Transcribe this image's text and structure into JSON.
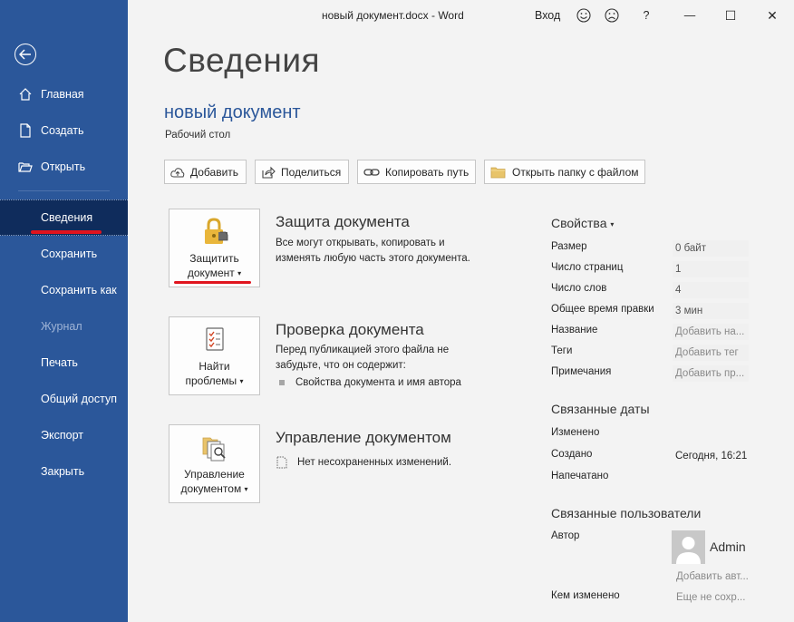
{
  "window": {
    "title": "новый документ.docx  -  Word",
    "signin": "Вход",
    "help": "?",
    "minimize": "—",
    "maximize": "☐",
    "close": "✕"
  },
  "sidebar": {
    "items": [
      {
        "label": "Главная"
      },
      {
        "label": "Создать"
      },
      {
        "label": "Открыть"
      },
      {
        "label": "Сведения"
      },
      {
        "label": "Сохранить"
      },
      {
        "label": "Сохранить как"
      },
      {
        "label": "Журнал"
      },
      {
        "label": "Печать"
      },
      {
        "label": "Общий доступ"
      },
      {
        "label": "Экспорт"
      },
      {
        "label": "Закрыть"
      }
    ]
  },
  "main": {
    "title": "Сведения",
    "doc_name": "новый документ",
    "doc_path": "Рабочий стол",
    "actions": {
      "upload": "Добавить",
      "share": "Поделиться",
      "copy_path": "Копировать путь",
      "open_folder": "Открыть папку с файлом"
    },
    "protect": {
      "btn_line1": "Защитить",
      "btn_line2": "документ",
      "title": "Защита документа",
      "desc_line1": "Все могут открывать, копировать и",
      "desc_line2": "изменять любую часть этого документа."
    },
    "inspect": {
      "btn_line1": "Найти",
      "btn_line2": "проблемы",
      "title": "Проверка документа",
      "desc_line1": "Перед публикацией этого файла не",
      "desc_line2": "забудьте, что он содержит:",
      "bullet": "Свойства документа и имя автора"
    },
    "manage": {
      "btn_line1": "Управление",
      "btn_line2": "документом",
      "title": "Управление документом",
      "note": "Нет несохраненных изменений."
    }
  },
  "properties": {
    "heading": "Свойства",
    "items": [
      {
        "label": "Размер",
        "value": "0 байт"
      },
      {
        "label": "Число страниц",
        "value": "1"
      },
      {
        "label": "Число слов",
        "value": "4"
      },
      {
        "label": "Общее время правки",
        "value": "3 мин"
      },
      {
        "label": "Название",
        "value": "Добавить на..."
      },
      {
        "label": "Теги",
        "value": "Добавить тег"
      },
      {
        "label": "Примечания",
        "value": "Добавить пр..."
      }
    ],
    "dates_heading": "Связанные даты",
    "dates": [
      {
        "label": "Изменено",
        "value": ""
      },
      {
        "label": "Создано",
        "value": "Сегодня, 16:21"
      },
      {
        "label": "Напечатано",
        "value": ""
      }
    ],
    "people_heading": "Связанные пользователи",
    "author_label": "Автор",
    "author_name": "Admin",
    "add_author": "Добавить авт...",
    "modified_by_label": "Кем изменено",
    "modified_by_value": "Еще не сохр..."
  },
  "colors": {
    "sidebar": "#2b579a",
    "sidebar_active": "#0f2c5c",
    "accent_link": "#2b579a",
    "annotation_red": "#e0141e"
  }
}
